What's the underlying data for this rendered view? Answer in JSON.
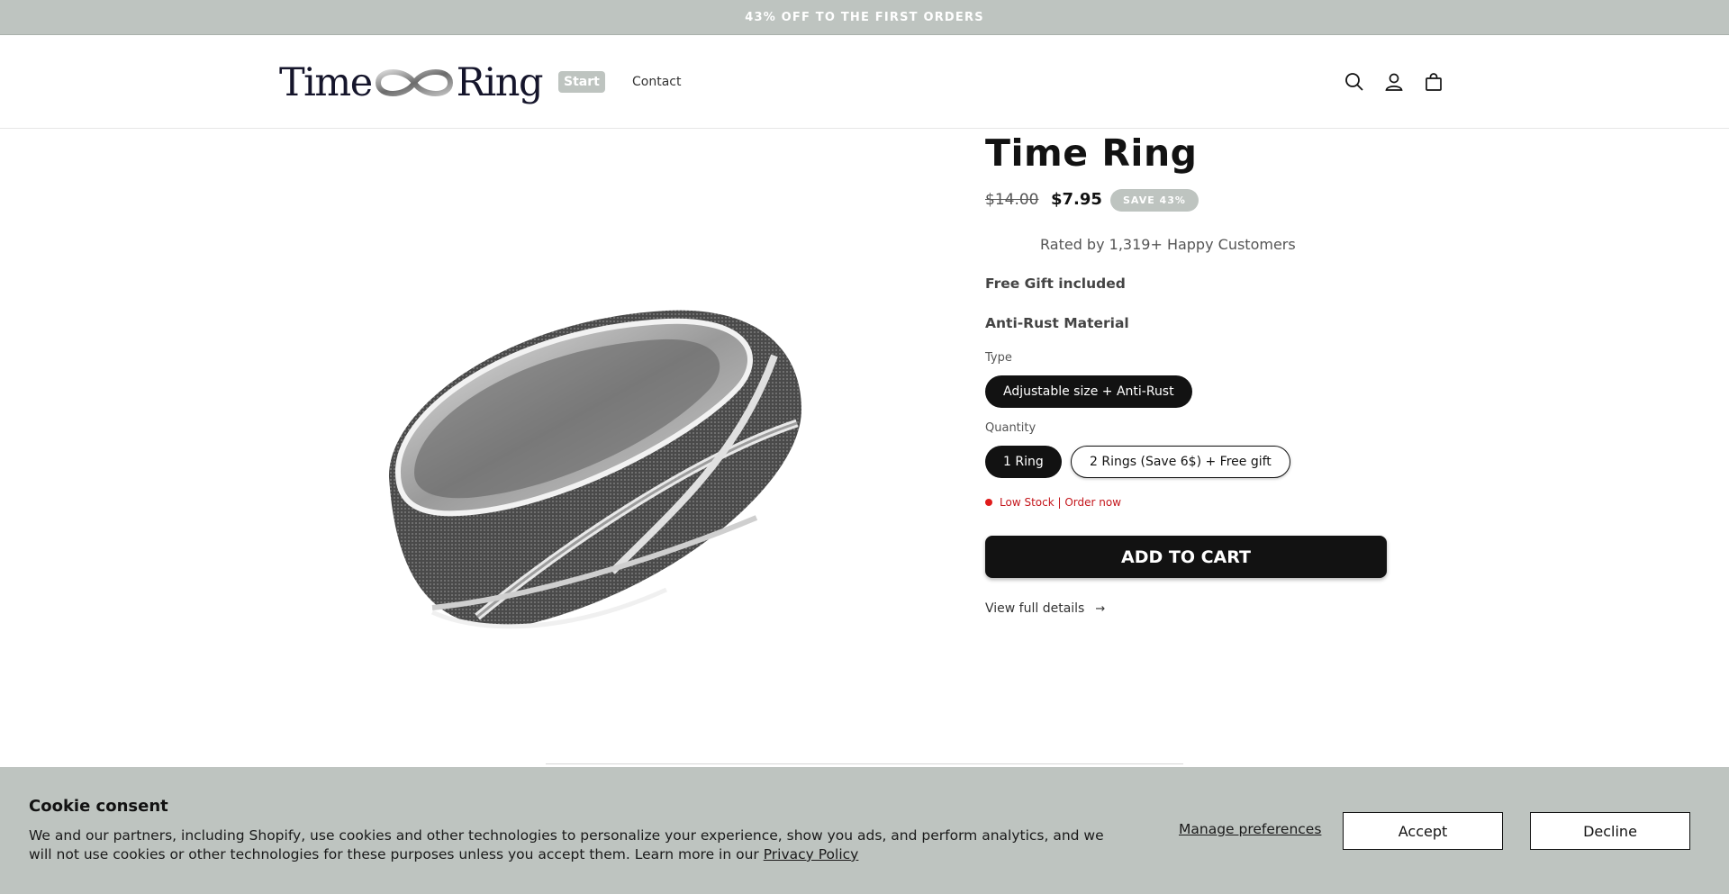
{
  "announcement": {
    "text": "43% OFF TO THE FIRST ORDERS"
  },
  "header": {
    "logo": {
      "left": "Time",
      "right": "Ring"
    },
    "nav": [
      {
        "label": "Start",
        "active": true
      },
      {
        "label": "Contact",
        "active": false
      }
    ],
    "icons": [
      "search-icon",
      "account-icon",
      "cart-icon"
    ]
  },
  "product": {
    "title": "Time Ring",
    "price_original": "$14.00",
    "price_sale": "$7.95",
    "save_badge": "SAVE 43%",
    "rating_text": "Rated by 1,319+ Happy Customers",
    "features": [
      "Free Gift included",
      "Anti-Rust Material"
    ],
    "type_label": "Type",
    "type_options": [
      {
        "label": "Adjustable size + Anti-Rust",
        "selected": true
      }
    ],
    "quantity_label": "Quantity",
    "quantity_options": [
      {
        "label": "1 Ring",
        "selected": true
      },
      {
        "label": "2 Rings (Save 6$) + Free gift",
        "selected": false
      }
    ],
    "stock_text": "Low Stock | Order now",
    "add_to_cart": "ADD TO CART",
    "view_details": "View full details",
    "view_details_arrow": "→"
  },
  "cookie": {
    "title": "Cookie consent",
    "body": "We and our partners, including Shopify, use cookies and other technologies to personalize your experience, show you ads, and perform analytics, and we will not use cookies or other technologies for these purposes unless you accept them. Learn more in our ",
    "privacy_link": "Privacy Policy",
    "manage": "Manage preferences",
    "accept": "Accept",
    "decline": "Decline"
  },
  "colors": {
    "announcement_bg": "#bec4c0",
    "cookie_bg": "#bec4c0",
    "primary_button": "#121212",
    "stock_red": "#e01b1b"
  }
}
